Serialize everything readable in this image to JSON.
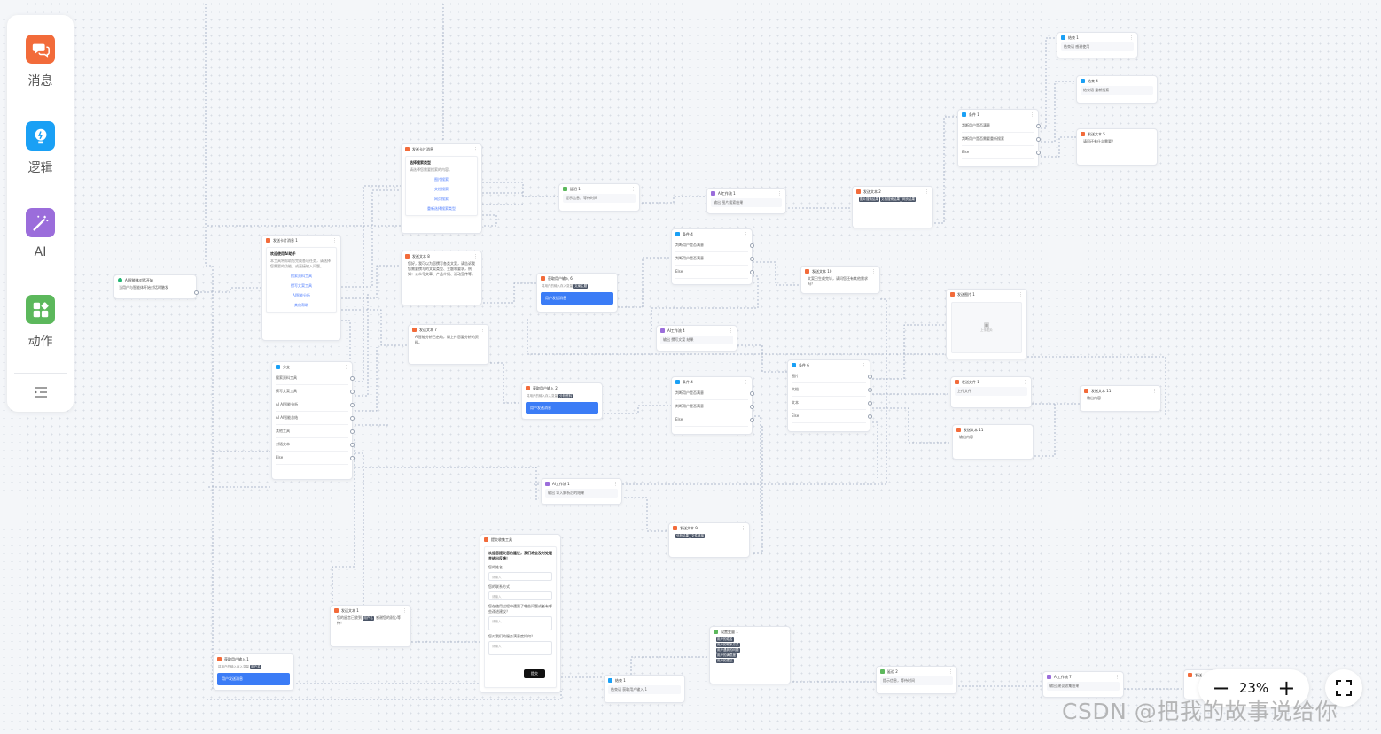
{
  "palette": {
    "items": [
      {
        "label": "消息",
        "icon": "message-icon",
        "color": "#f26b3a"
      },
      {
        "label": "逻辑",
        "icon": "logic-icon",
        "color": "#1aa0f5"
      },
      {
        "label": "AI",
        "icon": "magic-wand-icon",
        "color": "#9b6ddb"
      },
      {
        "label": "动作",
        "icon": "action-icon",
        "color": "#5cb85c"
      }
    ],
    "menu_icon": "collapse-menu-icon"
  },
  "zoom": {
    "minus": "−",
    "value": "23%",
    "plus": "+"
  },
  "watermark": "CSDN @把我的故事说给你",
  "colors": {
    "message": "#f26b3a",
    "logic": "#1aa0f5",
    "ai": "#9b6ddb",
    "action": "#5cb85c",
    "trigger": "#22b573",
    "button": "#3b7cf6"
  }
}
